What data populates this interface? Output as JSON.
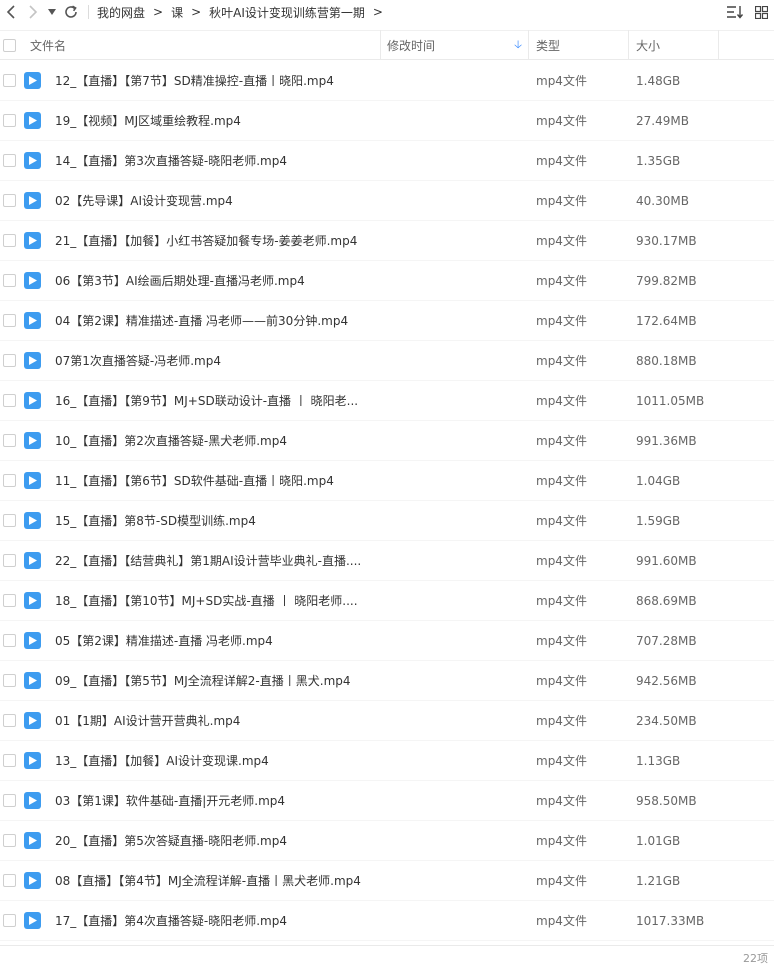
{
  "nav": {
    "back_icon": "chevron-left-icon",
    "forward_icon": "chevron-right-icon",
    "history_icon": "caret-down-icon",
    "refresh_icon": "refresh-icon"
  },
  "breadcrumb": [
    {
      "label": "我的网盘"
    },
    {
      "label": "课"
    },
    {
      "label": "秋叶AI设计变现训练营第一期"
    }
  ],
  "toolbar": {
    "sort_icon": "sort-list-icon",
    "grid_icon": "grid-view-icon"
  },
  "columns": {
    "name": "文件名",
    "modified": "修改时间",
    "type": "类型",
    "size": "大小"
  },
  "files": [
    {
      "name": "12_【直播】【第7节】SD精准操控-直播丨晓阳.mp4",
      "type": "mp4文件",
      "size": "1.48GB"
    },
    {
      "name": "19_【视频】MJ区域重绘教程.mp4",
      "type": "mp4文件",
      "size": "27.49MB"
    },
    {
      "name": "14_【直播】第3次直播答疑-晓阳老师.mp4",
      "type": "mp4文件",
      "size": "1.35GB"
    },
    {
      "name": "02【先导课】AI设计变现营.mp4",
      "type": "mp4文件",
      "size": "40.30MB"
    },
    {
      "name": "21_【直播】【加餐】小红书答疑加餐专场-姜姜老师.mp4",
      "type": "mp4文件",
      "size": "930.17MB"
    },
    {
      "name": "06【第3节】AI绘画后期处理-直播冯老师.mp4",
      "type": "mp4文件",
      "size": "799.82MB"
    },
    {
      "name": "04【第2课】精准描述-直播 冯老师——前30分钟.mp4",
      "type": "mp4文件",
      "size": "172.64MB"
    },
    {
      "name": "07第1次直播答疑-冯老师.mp4",
      "type": "mp4文件",
      "size": "880.18MB"
    },
    {
      "name": "16_【直播】【第9节】MJ+SD联动设计-直播 丨 晓阳老...",
      "type": "mp4文件",
      "size": "1011.05MB"
    },
    {
      "name": "10_【直播】第2次直播答疑-黑犬老师.mp4",
      "type": "mp4文件",
      "size": "991.36MB"
    },
    {
      "name": "11_【直播】【第6节】SD软件基础-直播丨晓阳.mp4",
      "type": "mp4文件",
      "size": "1.04GB"
    },
    {
      "name": "15_【直播】第8节-SD模型训练.mp4",
      "type": "mp4文件",
      "size": "1.59GB"
    },
    {
      "name": "22_【直播】【结营典礼】第1期AI设计营毕业典礼-直播....",
      "type": "mp4文件",
      "size": "991.60MB"
    },
    {
      "name": "18_【直播】【第10节】MJ+SD实战-直播 丨 晓阳老师....",
      "type": "mp4文件",
      "size": "868.69MB"
    },
    {
      "name": "05【第2课】精准描述-直播 冯老师.mp4",
      "type": "mp4文件",
      "size": "707.28MB"
    },
    {
      "name": "09_【直播】【第5节】MJ全流程详解2-直播丨黑犬.mp4",
      "type": "mp4文件",
      "size": "942.56MB"
    },
    {
      "name": "01【1期】AI设计营开营典礼.mp4",
      "type": "mp4文件",
      "size": "234.50MB"
    },
    {
      "name": "13_【直播】【加餐】AI设计变现课.mp4",
      "type": "mp4文件",
      "size": "1.13GB"
    },
    {
      "name": "03【第1课】软件基础-直播|开元老师.mp4",
      "type": "mp4文件",
      "size": "958.50MB"
    },
    {
      "name": "20_【直播】第5次答疑直播-晓阳老师.mp4",
      "type": "mp4文件",
      "size": "1.01GB"
    },
    {
      "name": "08【直播】【第4节】MJ全流程详解-直播丨黑犬老师.mp4",
      "type": "mp4文件",
      "size": "1.21GB"
    },
    {
      "name": "17_【直播】第4次直播答疑-晓阳老师.mp4",
      "type": "mp4文件",
      "size": "1017.33MB"
    }
  ],
  "footer": {
    "count_label": "22项"
  },
  "colors": {
    "accent": "#3d9cf0",
    "sort_arrow": "#3b8cff"
  }
}
